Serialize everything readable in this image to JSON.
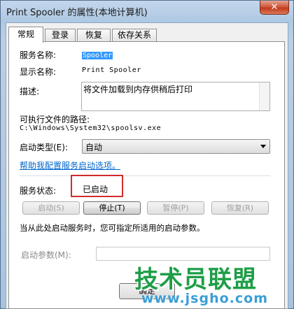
{
  "window": {
    "title": "Print Spooler 的属性(本地计算机)",
    "close_glyph": "✕"
  },
  "tabs": [
    {
      "label": "常规",
      "active": true
    },
    {
      "label": "登录",
      "active": false
    },
    {
      "label": "恢复",
      "active": false
    },
    {
      "label": "依存关系",
      "active": false
    }
  ],
  "general": {
    "service_name_label": "服务名称:",
    "service_name_value": "Spooler",
    "display_name_label": "显示名称:",
    "display_name_value": "Print Spooler",
    "description_label": "描述:",
    "description_value": "将文件加载到内存供稍后打印",
    "exe_path_label": "可执行文件的路径:",
    "exe_path_value": "C:\\Windows\\System32\\spoolsv.exe",
    "startup_type_label": "启动类型(E):",
    "startup_type_value": "自动",
    "help_link": "帮助我配置服务启动选项。",
    "status_label": "服务状态:",
    "status_value": "已启动",
    "buttons": {
      "start": "启动(S)",
      "stop": "停止(T)",
      "pause": "暂停(P)",
      "resume": "恢复(R)"
    },
    "hint": "当从此处启动服务时，您可指定所适用的启动参数。",
    "start_params_label": "启动参数(M):",
    "start_params_value": ""
  },
  "bottom_buttons": {
    "ok": "确定"
  },
  "watermark": {
    "big": "技术员联盟",
    "small": "www.jsgho.com"
  },
  "colors": {
    "highlight": "#d02c2c",
    "link": "#0066cc",
    "watermark_green": "#1e9e47",
    "watermark_blue": "#3a9fd6"
  }
}
